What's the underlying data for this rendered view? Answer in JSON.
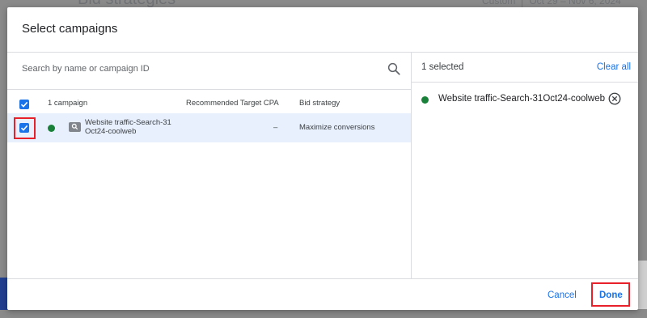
{
  "background": {
    "page_title": "Bid strategies",
    "date_range_label": "Custom",
    "date_range": "Oct 29 – Nov 6, 2024"
  },
  "dialog": {
    "title": "Select campaigns",
    "search": {
      "placeholder": "Search by name or campaign ID",
      "value": "",
      "icon": "search-icon"
    },
    "table": {
      "select_all_checked": true,
      "columns": [
        "1 campaign",
        "Recommended Target CPA",
        "Bid strategy"
      ],
      "rows": [
        {
          "checked": true,
          "status": "enabled",
          "status_color": "#188038",
          "type_icon": "search-campaign-icon",
          "name": "Website traffic-Search-31\nOct24-coolweb",
          "recommended_target_cpa": "–",
          "bid_strategy": "Maximize conversions"
        }
      ]
    },
    "selection": {
      "count_label": "1 selected",
      "clear_all_label": "Clear all",
      "items": [
        {
          "name": "Website traffic-Search-31Oct24-coolweb",
          "remove_icon": "remove-circle-icon"
        }
      ]
    },
    "footer": {
      "cancel_label": "Cancel",
      "done_label": "Done"
    },
    "accent_color": "#1a73e8",
    "highlight_color": "#e8202a"
  }
}
